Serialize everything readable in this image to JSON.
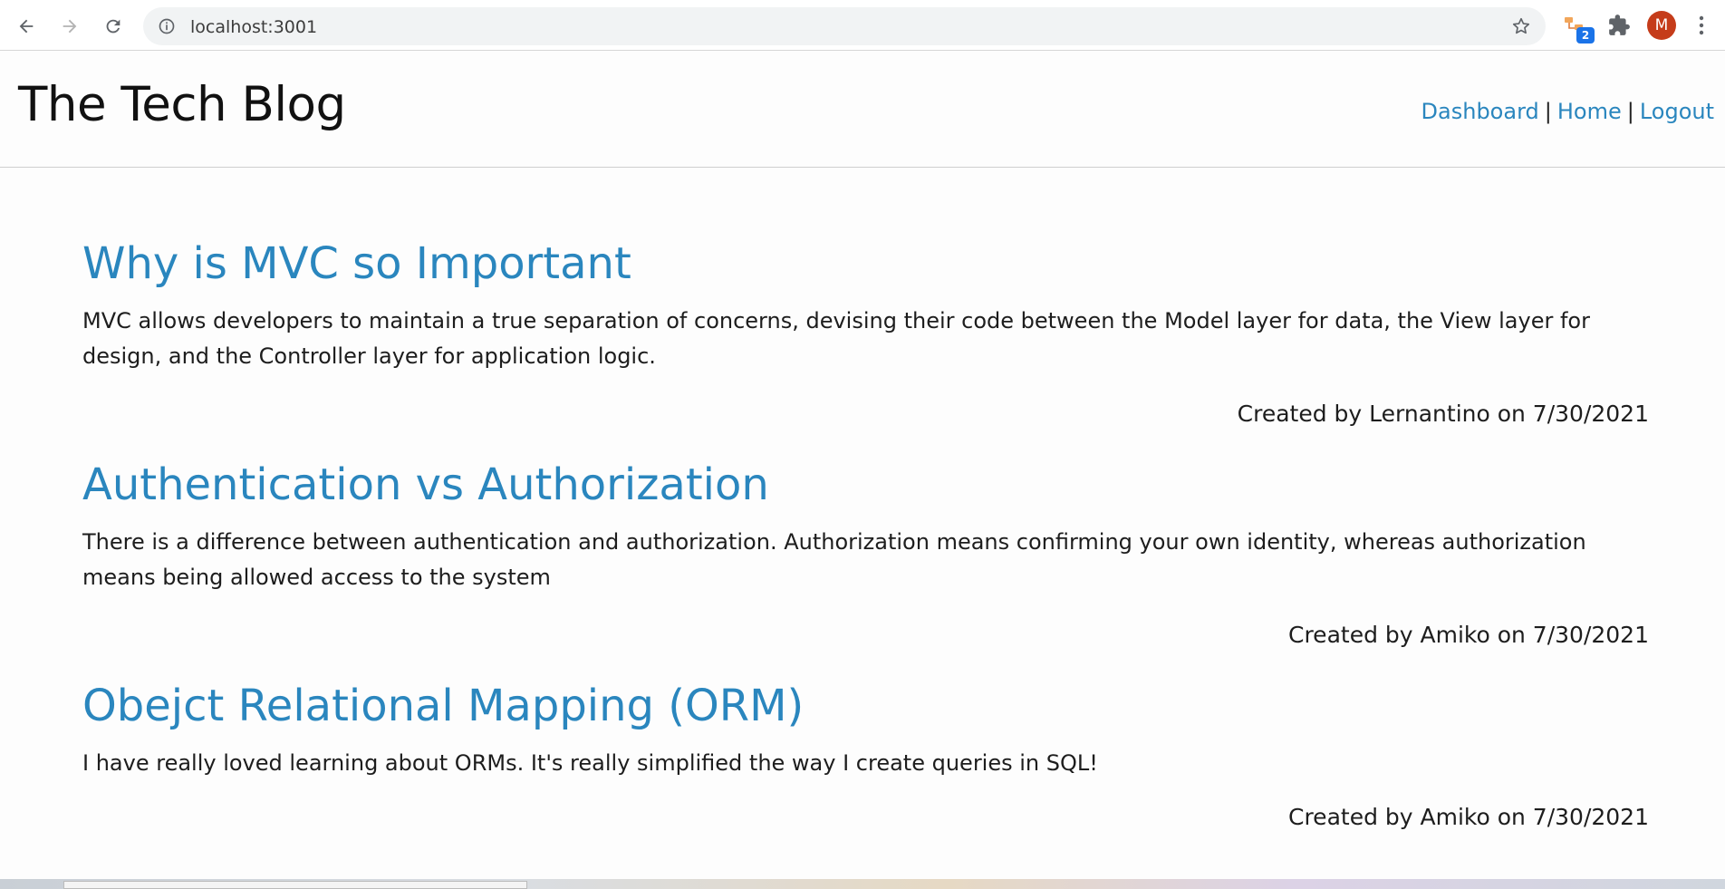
{
  "browser": {
    "url": "localhost:3001",
    "extension_badge": "2",
    "avatar_letter": "M"
  },
  "site": {
    "title": "The Tech Blog",
    "nav": {
      "dashboard": "Dashboard",
      "home": "Home",
      "logout": "Logout",
      "separator": "|"
    }
  },
  "posts": [
    {
      "title": "Why is MVC so Important",
      "body": "MVC allows developers to maintain a true separation of concerns, devising their code between the Model layer for data, the View layer for design, and the Controller layer for application logic.",
      "meta": "Created by Lernantino on 7/30/2021"
    },
    {
      "title": "Authentication vs Authorization",
      "body": "There is a difference between authentication and authorization. Authorization means confirming your own identity, whereas authorization means being allowed access to the system",
      "meta": "Created by Amiko on 7/30/2021"
    },
    {
      "title": "Obejct Relational Mapping (ORM)",
      "body": "I have really loved learning about ORMs. It's really simplified the way I create queries in SQL!",
      "meta": "Created by Amiko on 7/30/2021"
    }
  ],
  "colors": {
    "link": "#2a86be",
    "avatar": "#c53c1a",
    "badge": "#1a73e8"
  }
}
